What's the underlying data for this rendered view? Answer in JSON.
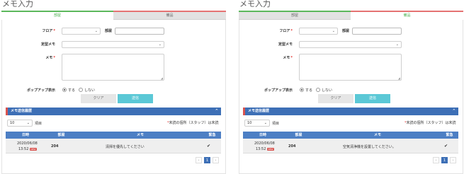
{
  "colors": {
    "accent_green": "#5cb85c",
    "accent_red": "#e57373",
    "header_blue": "#3d6fb6",
    "send_cyan": "#5bc8d6"
  },
  "panels": [
    {
      "title": "メモ入力",
      "tabs": [
        {
          "label": "部屋",
          "active": true
        },
        {
          "label": "備品",
          "active": false
        }
      ],
      "form": {
        "floor_label": "フロア",
        "required_mark": "*",
        "floor_value": "",
        "room_label": "部屋",
        "room_value": "",
        "template_label": "定型メモ",
        "template_value": "",
        "memo_label": "メモ",
        "memo_value": "",
        "popup_label": "ポップアップ表示",
        "popup_yes": "する",
        "popup_no": "しない",
        "clear_label": "クリア",
        "send_label": "送信"
      },
      "history": {
        "title": "メモ送信履歴",
        "caret": "^",
        "per_page": "10",
        "per_page_unit": "項目",
        "legend_star": "*",
        "legend_text": "未読の個所（スタッフ）は未読",
        "columns": [
          "日時",
          "部屋",
          "メモ",
          "緊急"
        ],
        "rows": [
          {
            "date": "2020/06/08",
            "time": "13:52",
            "badge": "NEW",
            "room": "204",
            "memo": "清掃を優先してください",
            "urgent": "✔"
          }
        ],
        "pager": [
          "‹",
          "1",
          "›"
        ]
      }
    },
    {
      "title": "メモ入力",
      "tabs": [
        {
          "label": "部屋",
          "active": false
        },
        {
          "label": "備品",
          "active": true
        }
      ],
      "form": {
        "floor_label": "フロア",
        "required_mark": "*",
        "floor_value": "",
        "room_label": "部屋",
        "room_value": "",
        "template_label": "定型メモ",
        "template_value": "",
        "memo_label": "メモ",
        "memo_value": "",
        "popup_label": "ポップアップ表示",
        "popup_yes": "する",
        "popup_no": "しない",
        "clear_label": "クリア",
        "send_label": "送信"
      },
      "history": {
        "title": "メモ送信履歴",
        "caret": "^",
        "per_page": "10",
        "per_page_unit": "項目",
        "legend_star": "*",
        "legend_text": "未読の個所（スタッフ）は未読",
        "columns": [
          "日時",
          "部屋",
          "メモ",
          "緊急"
        ],
        "rows": [
          {
            "date": "2020/06/08",
            "time": "13:52",
            "badge": "NEW",
            "room": "204",
            "memo": "空気清浄機を設置してください。",
            "urgent": "✔"
          }
        ],
        "pager": [
          "‹",
          "1",
          "›"
        ]
      }
    }
  ]
}
